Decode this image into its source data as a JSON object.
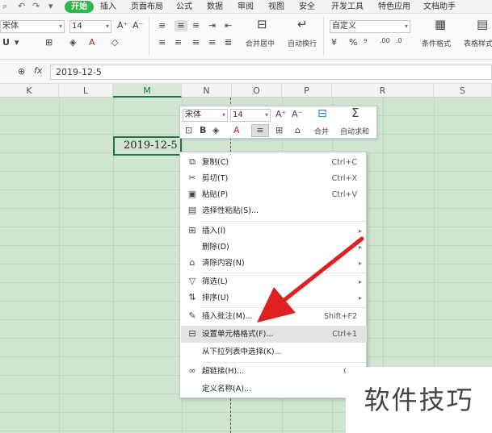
{
  "menu_tabs": {
    "start": "开始",
    "insert": "插入",
    "page_layout": "页面布局",
    "formulas": "公式",
    "data": "数据",
    "review": "审阅",
    "view": "视图",
    "security": "安全",
    "developer": "开发工具",
    "features": "特色应用",
    "doc_assistant": "文档助手"
  },
  "ribbon": {
    "font_name": "宋体",
    "font_size": "14",
    "merge_center": "合并居中",
    "wrap_text": "自动换行",
    "number_format": "自定义",
    "conditional_format": "条件格式",
    "table_style": "表格样式"
  },
  "formula_bar": {
    "fx": "fx",
    "value": "2019-12-5"
  },
  "columns": [
    "K",
    "L",
    "M",
    "N",
    "O",
    "P",
    "R",
    "S"
  ],
  "active_cell_value": "2019-12-5",
  "mini_toolbar": {
    "font_name": "宋体",
    "font_size": "14",
    "merge_label": "合并",
    "autosum_label": "自动求和"
  },
  "context_menu": {
    "items": [
      {
        "label": "复制(C)",
        "shortcut": "Ctrl+C"
      },
      {
        "label": "剪切(T)",
        "shortcut": "Ctrl+X"
      },
      {
        "label": "粘贴(P)",
        "shortcut": "Ctrl+V"
      },
      {
        "label": "选择性粘贴(S)...",
        "shortcut": ""
      },
      {
        "label": "插入(I)",
        "shortcut": ""
      },
      {
        "label": "删除(D)",
        "shortcut": ""
      },
      {
        "label": "清除内容(N)",
        "shortcut": ""
      },
      {
        "label": "筛选(L)",
        "shortcut": ""
      },
      {
        "label": "排序(U)",
        "shortcut": ""
      },
      {
        "label": "插入批注(M)...",
        "shortcut": "Shift+F2"
      },
      {
        "label": "设置单元格格式(F)...",
        "shortcut": "Ctrl+1"
      },
      {
        "label": "从下拉列表中选择(K)...",
        "shortcut": ""
      },
      {
        "label": "超链接(H)...",
        "shortcut": "Ctrl"
      },
      {
        "label": "定义名称(A)...",
        "shortcut": ""
      }
    ]
  },
  "watermark": "软件技巧",
  "colors": {
    "accent": "#2db84d",
    "grid_bg": "#cfe5d0",
    "annotation_arrow": "#e02020"
  }
}
